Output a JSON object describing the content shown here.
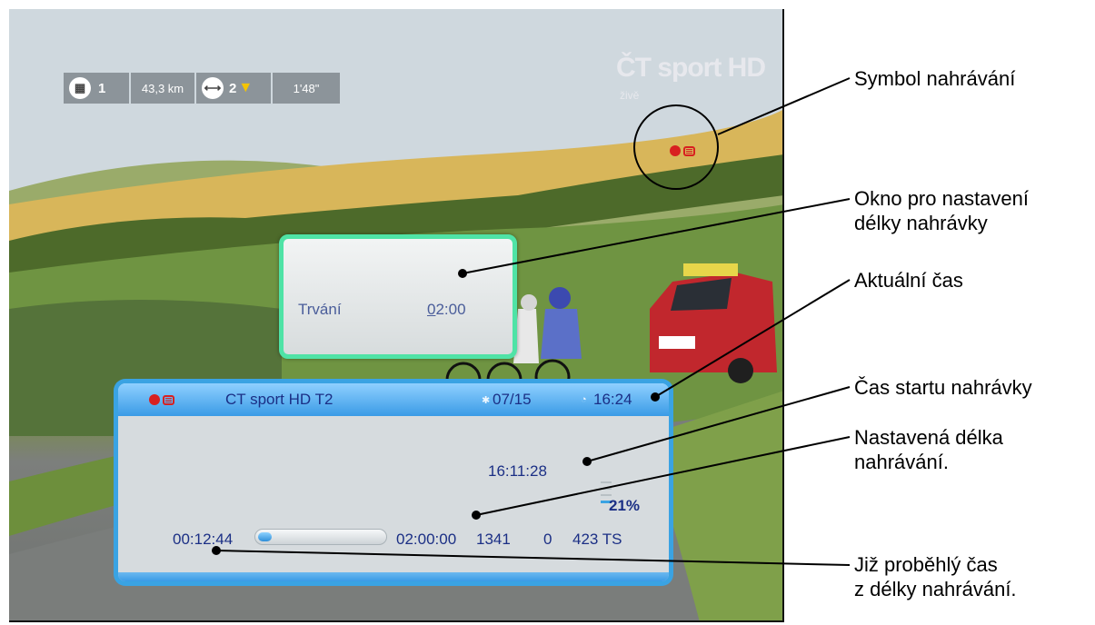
{
  "race_overlay": {
    "stage": "1",
    "distance": "43,3 km",
    "gap_group": "2",
    "gap_time": "1'48\""
  },
  "broadcaster": {
    "logo_text": "ČT sport HD",
    "live_label": "živě"
  },
  "duration_dialog": {
    "label": "Trvání",
    "value": "02:00",
    "accent_color": "#4fe3a6"
  },
  "recording_panel": {
    "channel": "CT sport HD T2",
    "date": "07/15",
    "clock": "16:24",
    "start_time": "16:11:28",
    "elapsed": "00:12:44",
    "total_duration": "02:00:00",
    "progress_fraction": 0.106,
    "signal_percent": "21%",
    "counter_a": "1341",
    "counter_b": "0",
    "counter_c": "423 TS",
    "header_color": "#3a9be6",
    "text_color": "#1b2f85",
    "rec_color": "#d82020"
  },
  "callouts": {
    "recording_symbol": "Symbol nahrávání",
    "duration_window": [
      "Okno pro nastavení",
      "délky nahrávky"
    ],
    "current_time": "Aktuální čas",
    "record_start": "Čas startu nahrávky",
    "set_length": [
      "Nastavená délka",
      "nahrávání."
    ],
    "elapsed": [
      "Již proběhlý čas",
      "z délky nahrávání."
    ]
  },
  "icons": {
    "stage_flag": "checkered-flag-icon",
    "gap": "left-right-arrow-icon",
    "jersey": "yellow-jersey-icon",
    "recording": "recording-dot-icon",
    "date": "calendar-icon",
    "clock": "clock-icon"
  }
}
